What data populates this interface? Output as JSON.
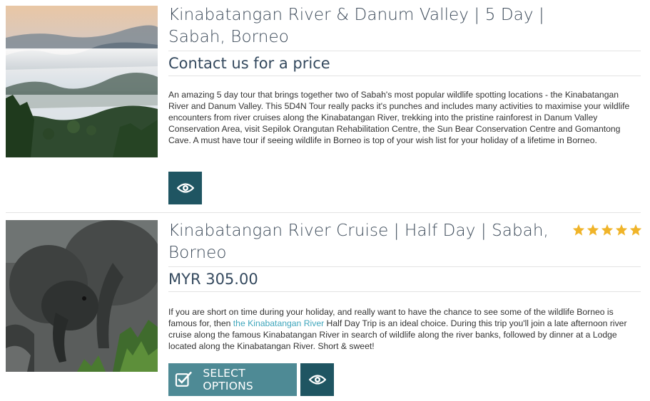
{
  "listings": [
    {
      "title": "Kinabatangan River & Danum Valley | 5 Day | Sabah, Borneo",
      "price": "Contact us for a price",
      "description": "An amazing 5 day tour that brings together two of Sabah's most popular wildlife spotting locations - the Kinabatangan River and Danum Valley. This 5D4N Tour really packs it's punches and includes many activities to maximise your wildlife encounters from river cruises along the Kinabatangan River, trekking into the pristine rainforest in Danum Valley Conservation Area, visit Sepilok Orangutan Rehabilitation Centre, the Sun Bear Conservation Centre and Gomantong Cave. A must have tour if seeing wildlife in Borneo is top of your wish list for your holiday of a lifetime in Borneo.",
      "view_icon": "eye-icon"
    },
    {
      "title": "Kinabatangan River Cruise | Half Day | Sabah, Borneo",
      "price": "MYR 305.00",
      "rating": 5,
      "description_before": "If you are short on time during your holiday, and really want to have the chance to see some of the wildlife Borneo is famous for, then ",
      "description_link": "the Kinabatangan River",
      "description_after": " Half Day Trip is an ideal choice. During this trip you'll join a late afternoon river cruise along the famous Kinabatangan River in search of wildlife along the river banks, followed by dinner at a Lodge located along the Kinabatangan River. Short & sweet!",
      "select_label": "SELECT OPTIONS",
      "select_icon": "checkbox-edit-icon",
      "view_icon": "eye-icon"
    }
  ],
  "colors": {
    "title": "#3d4b5a",
    "view_button": "#1f5562",
    "select_button": "#4e8a95",
    "link": "#3fa6bc",
    "star": "#f0b429"
  }
}
